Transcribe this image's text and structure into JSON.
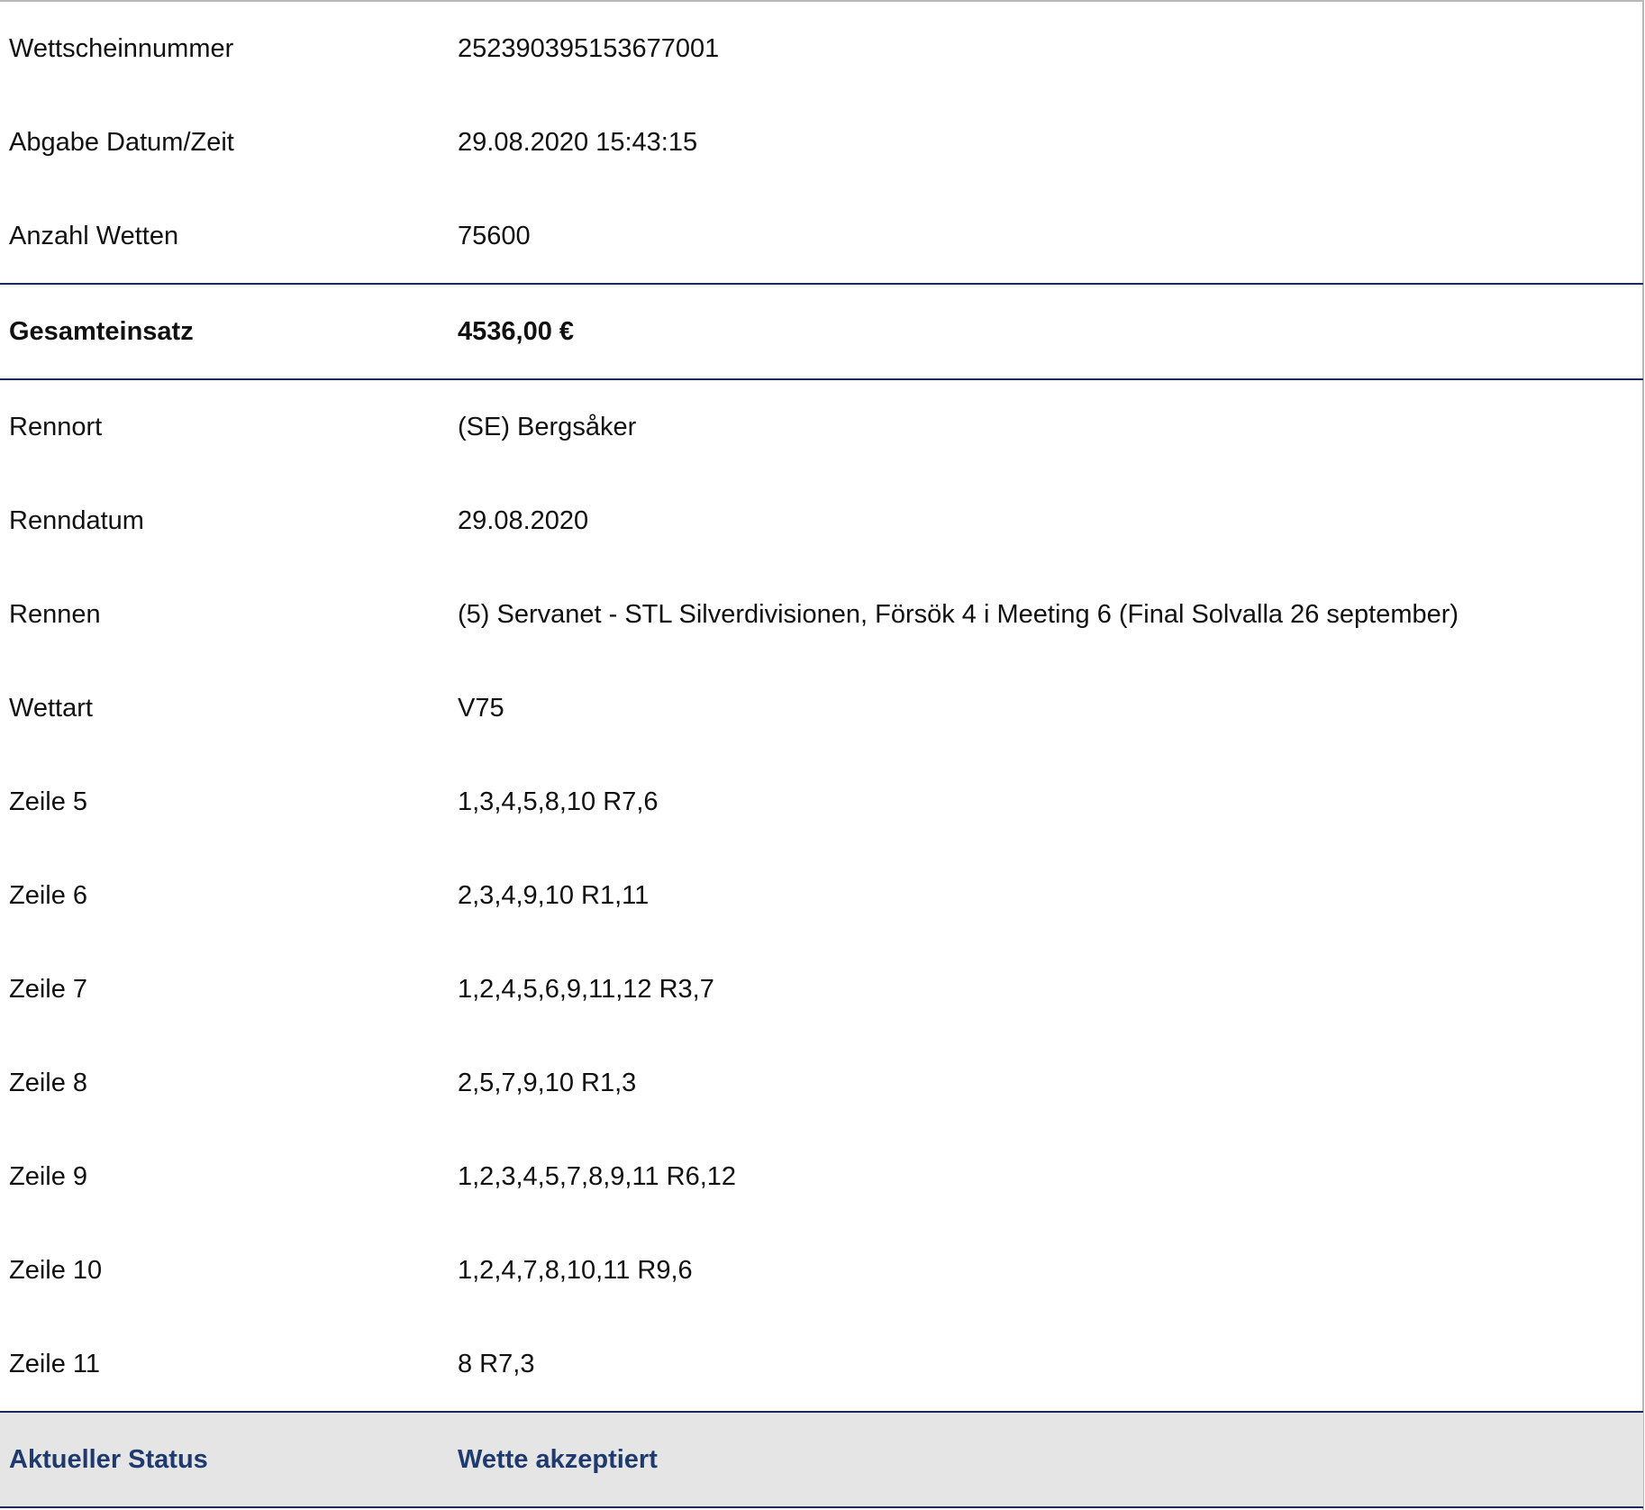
{
  "bet_slip": {
    "rows": [
      {
        "label": "Wettscheinnummer",
        "value": "252390395153677001"
      },
      {
        "label": "Abgabe Datum/Zeit",
        "value": "29.08.2020 15:43:15"
      },
      {
        "label": "Anzahl Wetten",
        "value": "75600"
      },
      {
        "label": "Gesamteinsatz",
        "value": "4536,00 €"
      },
      {
        "label": "Rennort",
        "value": "(SE) Bergsåker"
      },
      {
        "label": "Renndatum",
        "value": "29.08.2020"
      },
      {
        "label": "Rennen",
        "value": "(5) Servanet - STL Silverdivisionen, Försök 4 i Meeting 6 (Final Solvalla 26 september)"
      },
      {
        "label": "Wettart",
        "value": "V75"
      },
      {
        "label": "Zeile 5",
        "value": "1,3,4,5,8,10 R7,6"
      },
      {
        "label": "Zeile 6",
        "value": "2,3,4,9,10 R1,11"
      },
      {
        "label": "Zeile 7",
        "value": "1,2,4,5,6,9,11,12 R3,7"
      },
      {
        "label": "Zeile 8",
        "value": "2,5,7,9,10 R1,3"
      },
      {
        "label": "Zeile 9",
        "value": "1,2,3,4,5,7,8,9,11 R6,12"
      },
      {
        "label": "Zeile 10",
        "value": "1,2,4,7,8,10,11 R9,6"
      },
      {
        "label": "Zeile 11",
        "value": "8 R7,3"
      }
    ],
    "status": {
      "label": "Aktueller Status",
      "value": "Wette akzeptiert"
    }
  },
  "colors": {
    "rule": "#1c2a57",
    "status_text": "#1f3a6e",
    "status_background": "#e5e5e5"
  }
}
